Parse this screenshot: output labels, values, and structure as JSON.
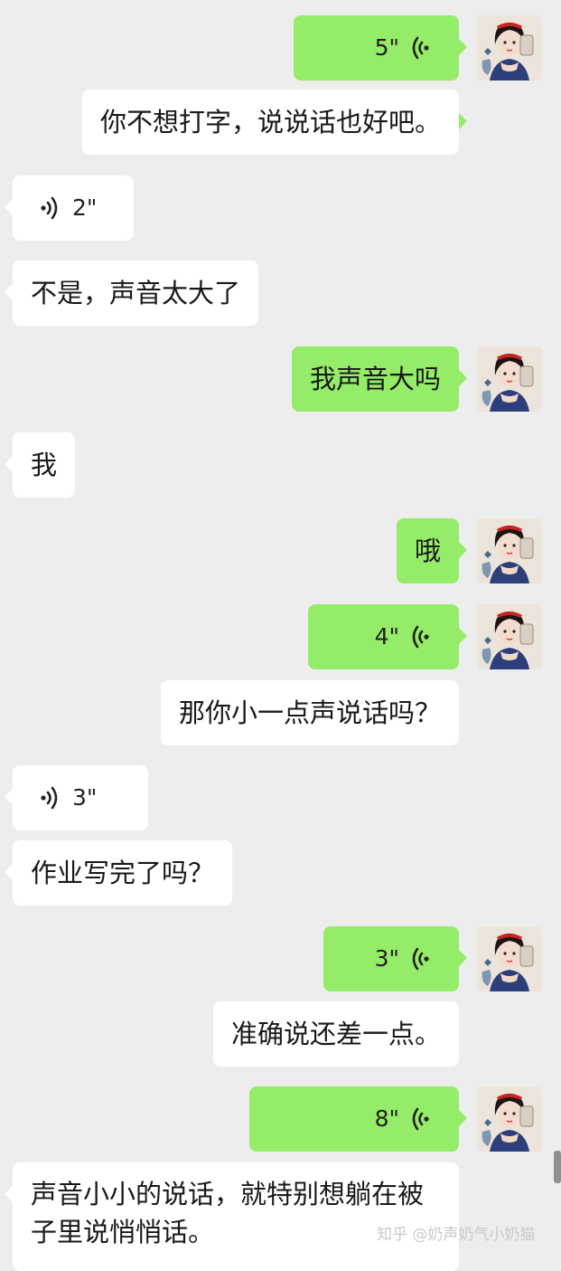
{
  "messages": [
    {
      "type": "voice",
      "side": "out",
      "duration": "5\""
    },
    {
      "type": "text",
      "side": "out",
      "text": "你不想打字，说说话也好吧。"
    },
    {
      "type": "voice",
      "side": "in",
      "duration": "2\""
    },
    {
      "type": "text",
      "side": "in",
      "text": "不是，声音太大了"
    },
    {
      "type": "text",
      "side": "out",
      "text": "我声音大吗"
    },
    {
      "type": "text",
      "side": "in",
      "text": "我"
    },
    {
      "type": "text",
      "side": "out",
      "text": "哦"
    },
    {
      "type": "voice",
      "side": "out",
      "duration": "4\""
    },
    {
      "type": "text",
      "side": "out",
      "text": "那你小一点声说话吗？"
    },
    {
      "type": "voice",
      "side": "in",
      "duration": "3\""
    },
    {
      "type": "text",
      "side": "in",
      "text": "作业写完了吗？"
    },
    {
      "type": "voice",
      "side": "out",
      "duration": "3\""
    },
    {
      "type": "text",
      "side": "out",
      "text": "准确说还差一点。"
    },
    {
      "type": "voice",
      "side": "out",
      "duration": "8\""
    },
    {
      "type": "text",
      "side": "in",
      "text": "声音小小的说话，就特别想躺在被子里说悄悄话。"
    }
  ],
  "watermark": "知乎 @奶声奶气小奶猫",
  "colors": {
    "background": "#ededed",
    "outgoing": "#95ec69",
    "incoming": "#ffffff"
  },
  "icons": {
    "voice": "voice-wave-icon",
    "avatar": "avatar-snow-white"
  }
}
